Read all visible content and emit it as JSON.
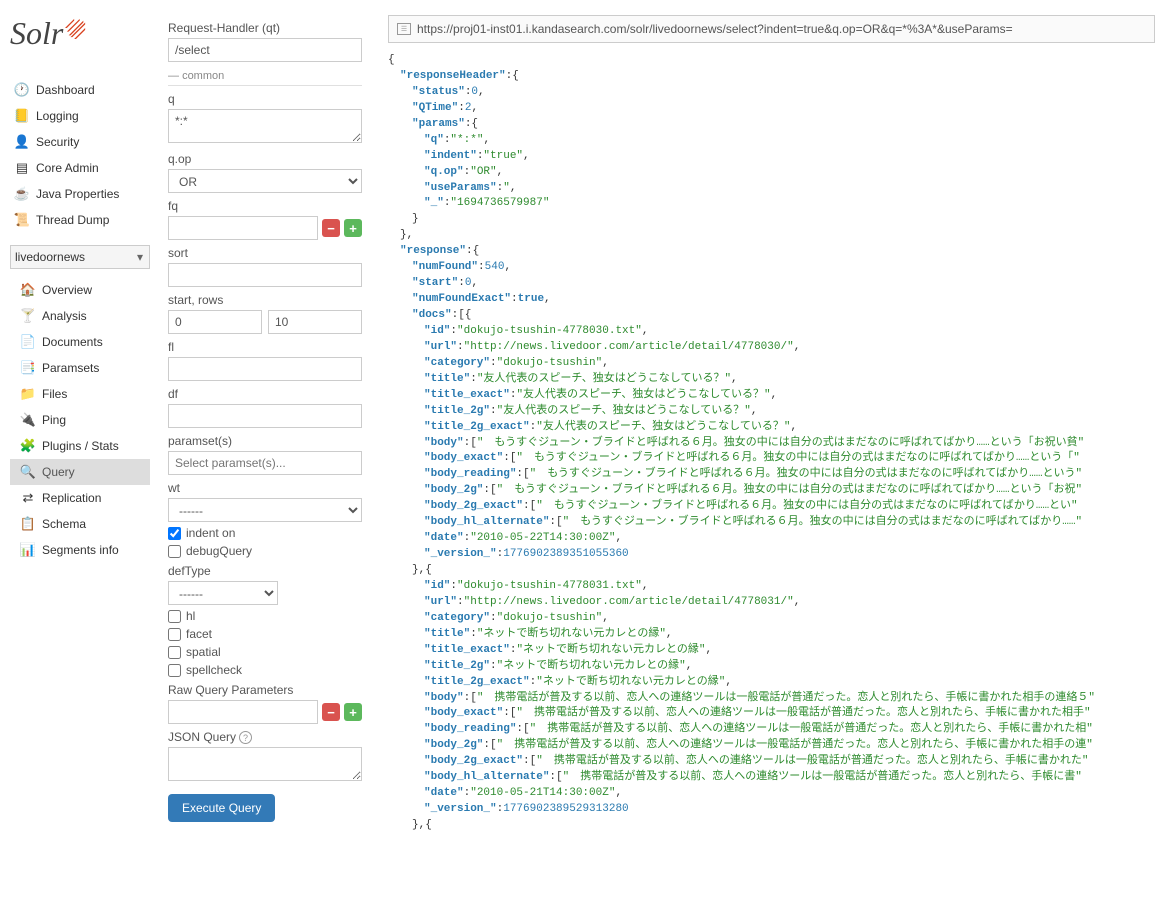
{
  "logo_text": "Solr",
  "nav": {
    "dashboard": "Dashboard",
    "logging": "Logging",
    "security": "Security",
    "core_admin": "Core Admin",
    "java_props": "Java Properties",
    "thread_dump": "Thread Dump"
  },
  "core_selector": "livedoornews",
  "sub_nav": {
    "overview": "Overview",
    "analysis": "Analysis",
    "documents": "Documents",
    "paramsets": "Paramsets",
    "files": "Files",
    "ping": "Ping",
    "plugins": "Plugins / Stats",
    "query": "Query",
    "replication": "Replication",
    "schema": "Schema",
    "segments": "Segments info"
  },
  "form": {
    "qt_label": "Request-Handler (qt)",
    "qt_value": "/select",
    "common_label": "common",
    "q_label": "q",
    "q_value": "*:*",
    "qop_label": "q.op",
    "qop_value": "OR",
    "fq_label": "fq",
    "sort_label": "sort",
    "startrows_label": "start, rows",
    "start_value": "0",
    "rows_value": "10",
    "fl_label": "fl",
    "df_label": "df",
    "paramset_label": "paramset(s)",
    "paramset_placeholder": "Select paramset(s)...",
    "wt_label": "wt",
    "wt_value": "------",
    "indent_label": "indent on",
    "debug_label": "debugQuery",
    "deftype_label": "defType",
    "deftype_value": "------",
    "hl_label": "hl",
    "facet_label": "facet",
    "spatial_label": "spatial",
    "spellcheck_label": "spellcheck",
    "raw_label": "Raw Query Parameters",
    "json_query_label": "JSON Query",
    "execute": "Execute Query"
  },
  "result_url": "https://proj01-inst01.i.kandasearch.com/solr/livedoornews/select?indent=true&q.op=OR&q=*%3A*&useParams=",
  "response": {
    "header": {
      "status": 0,
      "qtime": 2,
      "params": {
        "q": "*:*",
        "indent": "true",
        "q_op": "OR",
        "useParams": "",
        "ts": "1694736579987"
      }
    },
    "numFound": 540,
    "start": 0,
    "numFoundExact": "true",
    "doc1": {
      "id": "dokujo-tsushin-4778030.txt",
      "url": "http://news.livedoor.com/article/detail/4778030/",
      "category": "dokujo-tsushin",
      "title": "友人代表のスピーチ、独女はどうこなしている？",
      "title_exact": "友人代表のスピーチ、独女はどうこなしている？",
      "title_2g": "友人代表のスピーチ、独女はどうこなしている？",
      "title_2g_exact": "友人代表のスピーチ、独女はどうこなしている？",
      "body": "　もうすぐジューン・ブライドと呼ばれる６月。独女の中には自分の式はまだなのに呼ばれてばかり……という「お祝い貧",
      "body_exact": "　もうすぐジューン・ブライドと呼ばれる６月。独女の中には自分の式はまだなのに呼ばれてばかり……という「",
      "body_reading": "　もうすぐジューン・ブライドと呼ばれる６月。独女の中には自分の式はまだなのに呼ばれてばかり……という",
      "body_2g": "　もうすぐジューン・ブライドと呼ばれる６月。独女の中には自分の式はまだなのに呼ばれてばかり……という「お祝",
      "body_2g_exact": "　もうすぐジューン・ブライドと呼ばれる６月。独女の中には自分の式はまだなのに呼ばれてばかり……とい",
      "body_hl_alternate": "　もうすぐジューン・ブライドと呼ばれる６月。独女の中には自分の式はまだなのに呼ばれてばかり……",
      "date": "2010-05-22T14:30:00Z",
      "version": "1776902389351055360"
    },
    "doc2": {
      "id": "dokujo-tsushin-4778031.txt",
      "url": "http://news.livedoor.com/article/detail/4778031/",
      "category": "dokujo-tsushin",
      "title": "ネットで断ち切れない元カレとの縁",
      "title_exact": "ネットで断ち切れない元カレとの縁",
      "title_2g": "ネットで断ち切れない元カレとの縁",
      "title_2g_exact": "ネットで断ち切れない元カレとの縁",
      "body": "　携帯電話が普及する以前、恋人への連絡ツールは一般電話が普通だった。恋人と別れたら、手帳に書かれた相手の連絡５",
      "body_exact": "　携帯電話が普及する以前、恋人への連絡ツールは一般電話が普通だった。恋人と別れたら、手帳に書かれた相手",
      "body_reading": "　携帯電話が普及する以前、恋人への連絡ツールは一般電話が普通だった。恋人と別れたら、手帳に書かれた相",
      "body_2g": "　携帯電話が普及する以前、恋人への連絡ツールは一般電話が普通だった。恋人と別れたら、手帳に書かれた相手の連",
      "body_2g_exact": "　携帯電話が普及する以前、恋人への連絡ツールは一般電話が普通だった。恋人と別れたら、手帳に書かれた",
      "body_hl_alternate": "　携帯電話が普及する以前、恋人への連絡ツールは一般電話が普通だった。恋人と別れたら、手帳に書",
      "date": "2010-05-21T14:30:00Z",
      "version": "1776902389529313280"
    }
  }
}
